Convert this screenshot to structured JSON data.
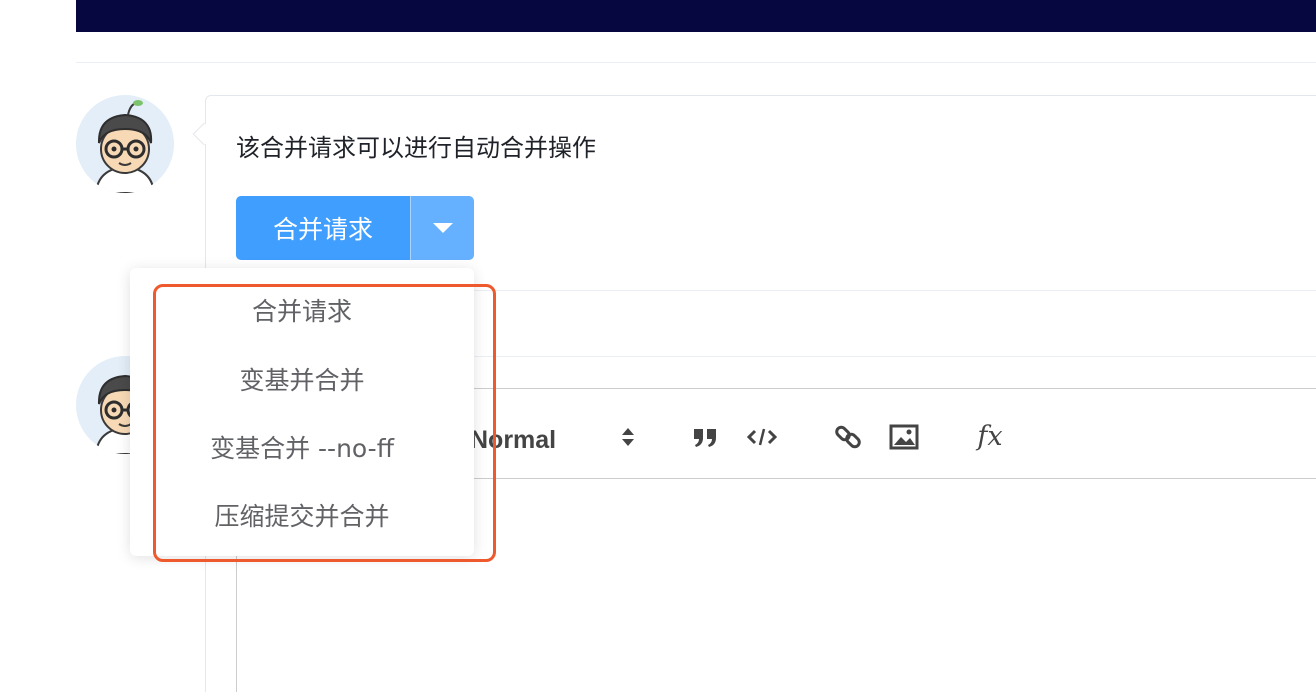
{
  "merge_panel": {
    "message": "该合并请求可以进行自动合并操作",
    "merge_button_label": "合并请求"
  },
  "dropdown": {
    "items": [
      {
        "label": "合并请求"
      },
      {
        "label": "变基并合并"
      },
      {
        "label": "变基合并 --no-ff"
      },
      {
        "label": "压缩提交并合并"
      }
    ]
  },
  "editor": {
    "header_select": "Normal",
    "toolbar_icons": [
      "sort-icon",
      "blockquote-icon",
      "code-icon",
      "link-icon",
      "image-icon",
      "formula-icon"
    ],
    "formula_glyph": "fx"
  },
  "colors": {
    "topbar": "#060640",
    "primary": "#409eff",
    "primary_light": "#66b1ff",
    "highlight_border": "#ee5a2e"
  }
}
